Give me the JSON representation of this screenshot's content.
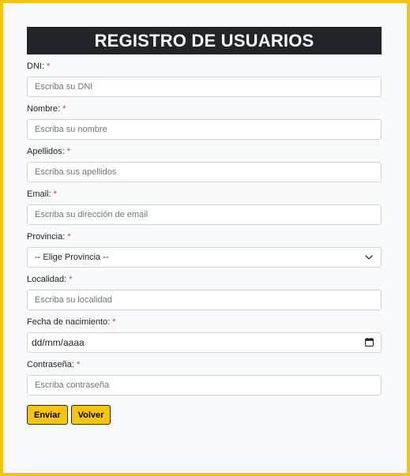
{
  "header": {
    "title": "REGISTRO DE USUARIOS"
  },
  "required_mark": "*",
  "fields": {
    "dni": {
      "label": "DNI:",
      "placeholder": "Escriba su DNI"
    },
    "nombre": {
      "label": "Nombre:",
      "placeholder": "Escriba su nombre"
    },
    "apellidos": {
      "label": "Apellidos:",
      "placeholder": "Escriba sus apellidos"
    },
    "email": {
      "label": "Email:",
      "placeholder": "Escriba su dirección de email"
    },
    "provincia": {
      "label": "Provincia:",
      "selected": "-- Elige Provincia --"
    },
    "localidad": {
      "label": "Localidad:",
      "placeholder": "Escriba su localidad"
    },
    "fecha": {
      "label": "Fecha de nacimiento:",
      "value": "dd/mm/aaaa"
    },
    "contrasena": {
      "label": "Contraseña:",
      "placeholder": "Escriba contraseña"
    }
  },
  "buttons": {
    "submit": "Enviar",
    "back": "Volver"
  },
  "colors": {
    "accent": "#f7c600",
    "header_bg": "#212529",
    "required": "#dc3545"
  },
  "icons": {
    "select": "chevron-down-icon",
    "date": "calendar-icon"
  }
}
